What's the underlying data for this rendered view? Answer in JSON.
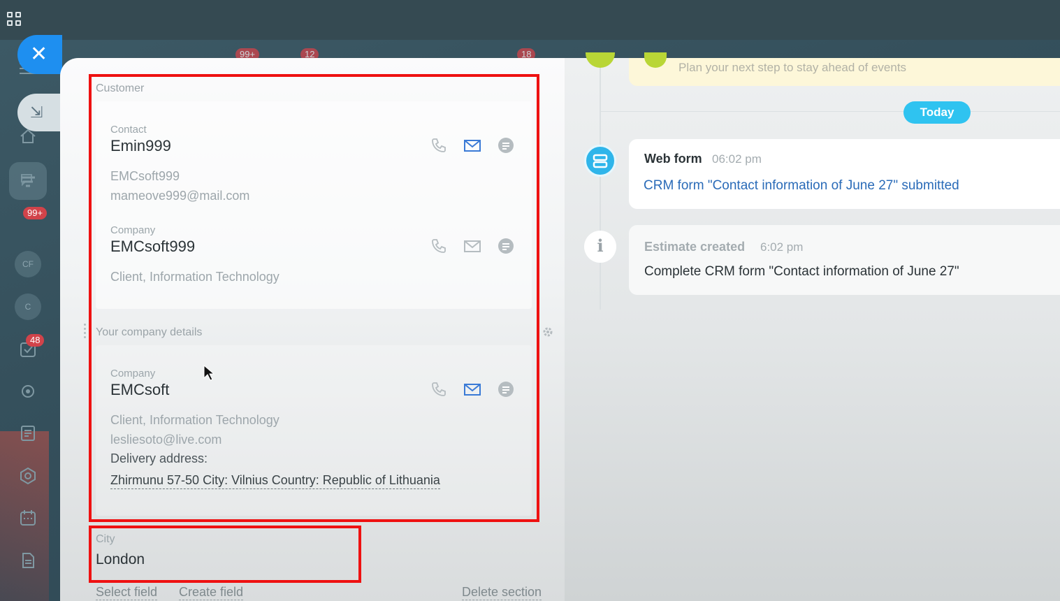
{
  "top_counts": [
    "99+",
    "12",
    "18"
  ],
  "rail": {
    "badge_tile": "99+",
    "circle_1": "CF",
    "circle_2": "C",
    "tasks_count": "48"
  },
  "customer": {
    "section_title": "Customer",
    "contact": {
      "label": "Contact",
      "name": "Emin999",
      "company": "EMCsoft999",
      "email": "mameove999@mail.com"
    },
    "company": {
      "label": "Company",
      "name": "EMCsoft999",
      "type": "Client, Information Technology"
    }
  },
  "your_company": {
    "section_title": "Your company details",
    "label": "Company",
    "name": "EMCsoft",
    "type": "Client, Information Technology",
    "email": "lesliesoto@live.com",
    "delivery_label": "Delivery address:",
    "address": "Zhirmunu 57-50 City: Vilnius Country: Republic of Lithuania"
  },
  "city": {
    "label": "City",
    "value": "London"
  },
  "bottom_links": {
    "select_field": "Select field",
    "create_field": "Create field",
    "delete_section": "Delete section"
  },
  "timeline": {
    "hint": "Plan your next step to stay ahead of events",
    "today": "Today",
    "web_form": {
      "title": "Web form",
      "time": "06:02 pm",
      "link": "CRM form \"Contact information of June 27\" submitted"
    },
    "estimate": {
      "title": "Estimate created",
      "time": "6:02 pm",
      "text": "Complete CRM form \"Contact information of June 27\""
    }
  },
  "colors": {
    "accent_blue": "#1e8ff0",
    "today_blue": "#2fc3f0",
    "highlight_red": "#ee1111",
    "badge_red": "#d1434a"
  }
}
